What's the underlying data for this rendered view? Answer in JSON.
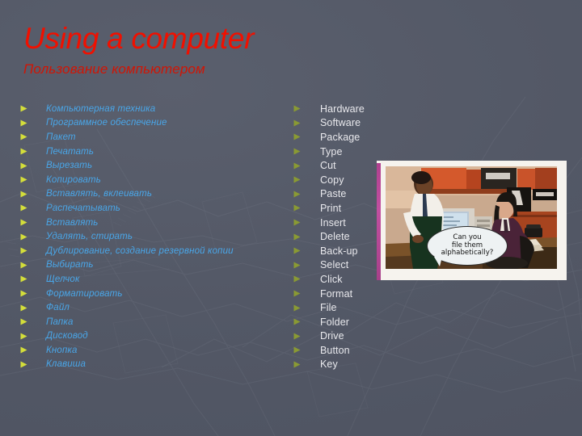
{
  "slide": {
    "title": "Using a computer",
    "subtitle": "Пользование компьютером",
    "background_color": "#565b69",
    "title_color": "#f01000",
    "russian_text_color": "#49a6e8",
    "english_text_color": "#e8e8ec",
    "bullet_color_russian": "#d4de3a",
    "bullet_color_english": "#8a9a33"
  },
  "columns": {
    "russian": {
      "name": "russian-terms",
      "items": [
        "Компьютерная техника",
        "Программное обеспечение",
        "Пакет",
        "Печатать",
        "Вырезать",
        "Копировать",
        "Вставлять, вклеивать",
        "Распечатывать",
        "Вставлять",
        "Удалять, стирать",
        "Дублирование, создание резервной копии",
        "Выбирать",
        "Щелчок",
        "Форматировать",
        "Файл",
        "Папка",
        "Дисковод",
        "Кнопка",
        "Клавиша"
      ]
    },
    "english": {
      "name": "english-terms",
      "items": [
        "Hardware",
        "Software",
        "Package",
        "Type",
        "Cut",
        "Copy",
        "Paste",
        "Print",
        "Insert",
        "Delete",
        "Back-up",
        "Select",
        "Click",
        "Format",
        "File",
        "Folder",
        "Drive",
        "Button",
        "Key"
      ]
    }
  },
  "photo": {
    "name": "office-cartoon-photo",
    "speech_bubble": {
      "line1": "Can you",
      "line2": "file them",
      "line3": "alphabetically?"
    },
    "accent_bar_color": "#b0408f",
    "frame_color": "#f6f3ee"
  },
  "icons": {
    "bullet": "triangle-right-icon"
  }
}
